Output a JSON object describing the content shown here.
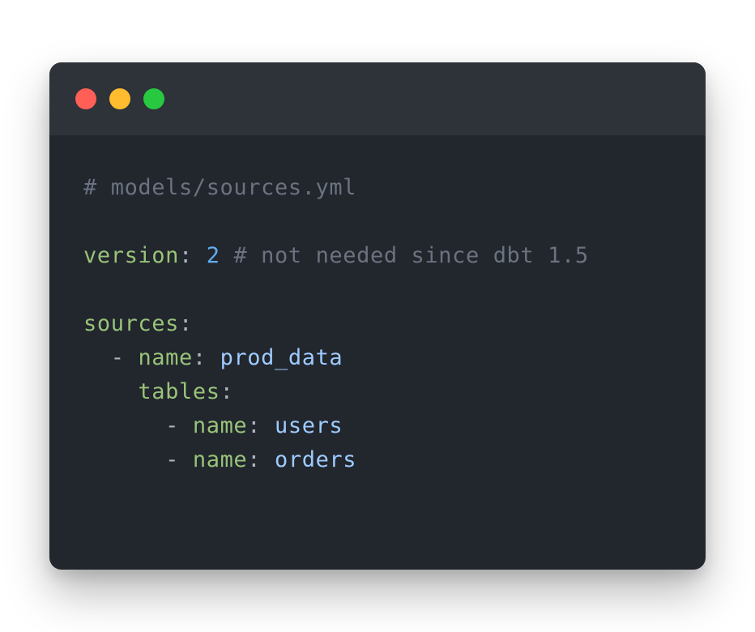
{
  "window": {
    "buttons": {
      "close_color": "#ff5f57",
      "minimize_color": "#febc2e",
      "maximize_color": "#28c840"
    }
  },
  "code": {
    "lines": [
      {
        "comment": "# models/sources.yml"
      },
      {},
      {
        "key": "version",
        "colon": ":",
        "number": "2",
        "comment": "# not needed since dbt 1.5"
      },
      {},
      {
        "key": "sources",
        "colon": ":"
      },
      {
        "indent": "  ",
        "dash": "-",
        "key": "name",
        "colon": ":",
        "value": "prod_data"
      },
      {
        "indent": "    ",
        "key": "tables",
        "colon": ":"
      },
      {
        "indent": "      ",
        "dash": "-",
        "key": "name",
        "colon": ":",
        "value": "users"
      },
      {
        "indent": "      ",
        "dash": "-",
        "key": "name",
        "colon": ":",
        "value": "orders"
      }
    ]
  },
  "colors": {
    "background": "#22262d",
    "titlebar": "#2e3239",
    "comment": "#6b7280",
    "key": "#98c379",
    "number": "#61afef",
    "value": "#9ecbff"
  }
}
